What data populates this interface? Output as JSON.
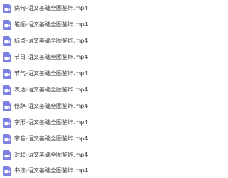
{
  "icon": {
    "name": "video-file-icon",
    "color": "#7b7fe0",
    "play_color": "#ffffff"
  },
  "files": [
    {
      "name": "病句-语文基础全图鉴炸.mp4"
    },
    {
      "name": "笔顺-语文基础全图鉴炸.mp4"
    },
    {
      "name": "标点-语文基础全图鉴炸.mp4"
    },
    {
      "name": "节日-语文基础全图鉴炸.mp4"
    },
    {
      "name": "节气-语文基础全图鉴炸.mp4"
    },
    {
      "name": "表达-语文基础全图鉴炸.mp4"
    },
    {
      "name": "修辞-语文基础全图鉴炸.mp4"
    },
    {
      "name": "字形-语文基础全图鉴炸.mp4"
    },
    {
      "name": "字音-语文基础全图鉴炸.mp4"
    },
    {
      "name": "对联-语文基础全图鉴炸.mp4"
    },
    {
      "name": "书法-语文基础全图鉴炸.mp4"
    }
  ]
}
